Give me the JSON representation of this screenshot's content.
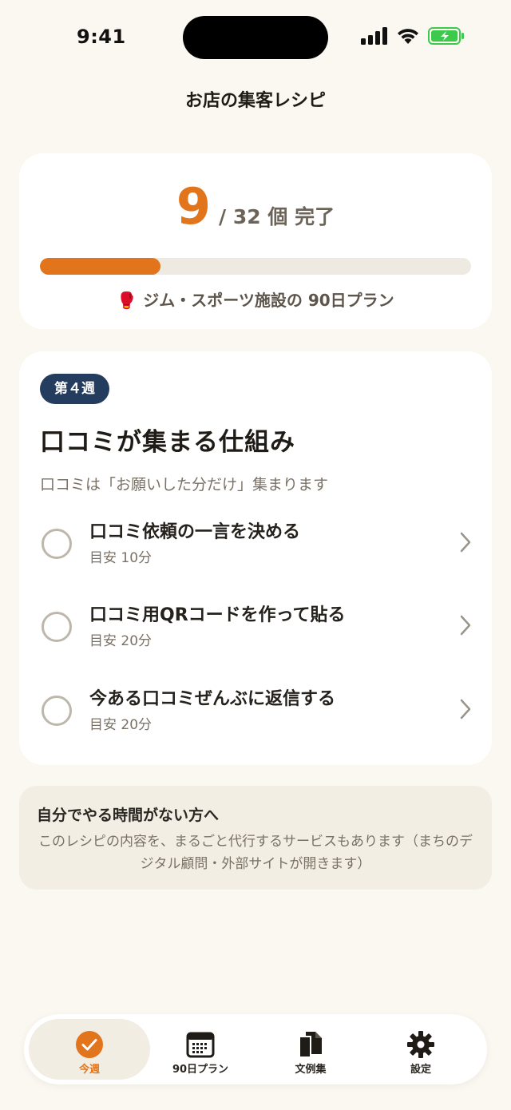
{
  "status_bar": {
    "time": "9:41"
  },
  "app": {
    "title": "お店の集客レシピ"
  },
  "progress": {
    "completed": "9",
    "total_label": "/ 32 個 完了",
    "fraction": 0.28,
    "plan_emoji": "🥊",
    "plan_label": "ジム・スポーツ施設の 90日プラン"
  },
  "week": {
    "badge": "第４週",
    "title": "口コミが集まる仕組み",
    "subtitle": "口コミは「お願いした分だけ」集まります",
    "tasks": [
      {
        "title": "口コミ依頼の一言を決める",
        "time": "目安 10分"
      },
      {
        "title": "口コミ用QRコードを作って貼る",
        "time": "目安 20分"
      },
      {
        "title": "今ある口コミぜんぶに返信する",
        "time": "目安 20分"
      }
    ]
  },
  "outsource": {
    "title": "自分でやる時間がない方へ",
    "body": "このレシピの内容を、まるごと代行するサービスもあります（まちのデジタル顧問・外部サイトが開きます）"
  },
  "tabs": [
    {
      "label": "今週",
      "icon": "check-circle-icon",
      "active": true
    },
    {
      "label": "90日プラン",
      "icon": "calendar-icon",
      "active": false
    },
    {
      "label": "文例集",
      "icon": "documents-icon",
      "active": false
    },
    {
      "label": "設定",
      "icon": "gear-icon",
      "active": false
    }
  ],
  "colors": {
    "accent": "#e2741b",
    "badge": "#243c5e",
    "background": "#fbf8f1"
  }
}
